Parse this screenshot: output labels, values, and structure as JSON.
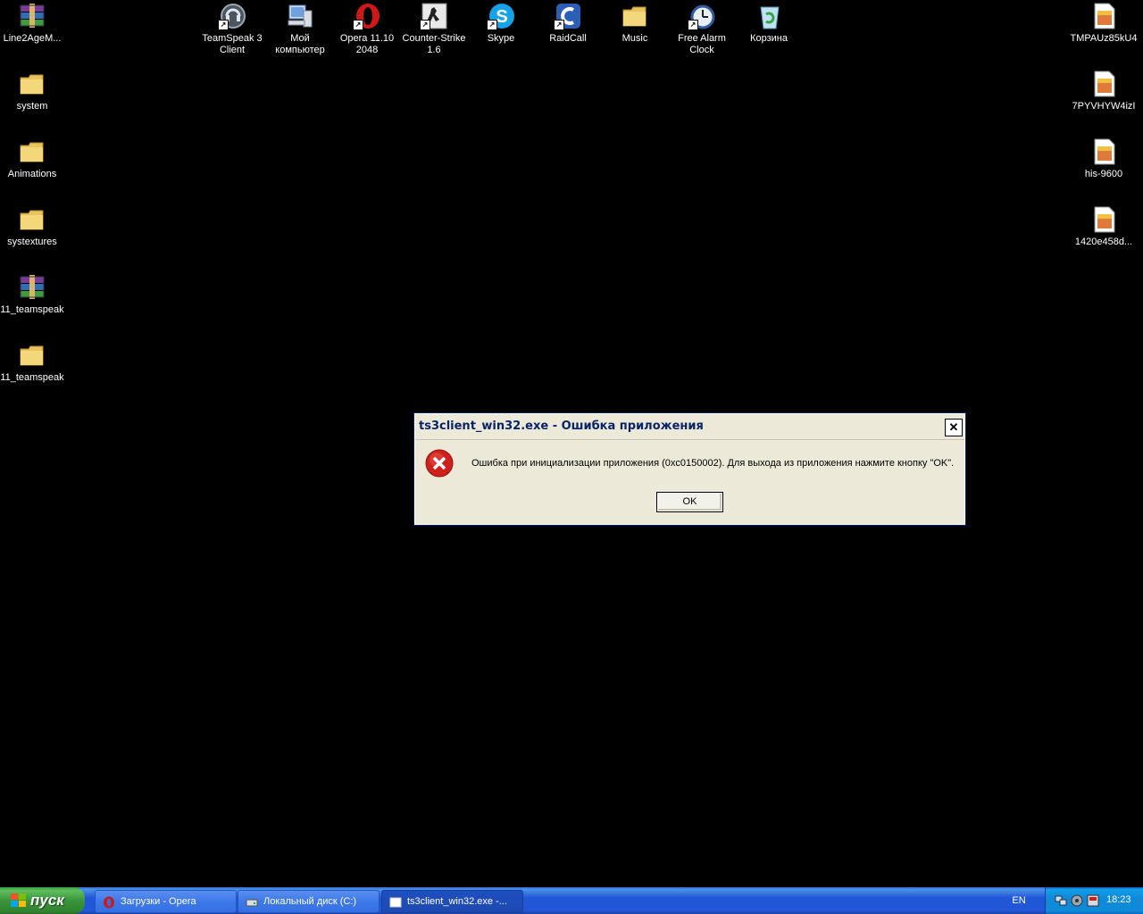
{
  "desktop": {
    "left_icons": [
      {
        "label": "Line2AgeM...",
        "icon": "winrar-archive-icon"
      },
      {
        "label": "system",
        "icon": "folder-icon"
      },
      {
        "label": "Animations",
        "icon": "folder-icon"
      },
      {
        "label": "systextures",
        "icon": "folder-icon"
      },
      {
        "label": "11_teamspeak",
        "icon": "winrar-archive-icon"
      },
      {
        "label": "11_teamspeak",
        "icon": "folder-icon"
      }
    ],
    "top_icons": [
      {
        "label": "TeamSpeak 3 Client",
        "icon": "teamspeak-icon"
      },
      {
        "label": "Мой компьютер",
        "icon": "my-computer-icon"
      },
      {
        "label": "Opera 11.10 2048",
        "icon": "opera-icon"
      },
      {
        "label": "Counter-Strike 1.6",
        "icon": "counter-strike-icon"
      },
      {
        "label": "Skype",
        "icon": "skype-icon"
      },
      {
        "label": "RaidCall",
        "icon": "raidcall-icon"
      },
      {
        "label": "Music",
        "icon": "folder-icon"
      },
      {
        "label": "Free Alarm Clock",
        "icon": "alarm-clock-icon"
      },
      {
        "label": "Корзина",
        "icon": "recycle-bin-icon"
      }
    ],
    "right_icons": [
      {
        "label": "TMPAUz85kU4",
        "icon": "image-file-icon"
      },
      {
        "label": "7PYVHYW4izI",
        "icon": "image-file-icon"
      },
      {
        "label": "his-9600",
        "icon": "image-file-icon"
      },
      {
        "label": "1420e458d...",
        "icon": "image-file-icon"
      }
    ]
  },
  "dialog": {
    "title": "ts3client_win32.exe - Ошибка приложения",
    "message": "Ошибка при инициализации приложения (0xc0150002). Для выхода из приложения нажмите кнопку \"OK\".",
    "ok_label": "OK",
    "close_symbol": "✕"
  },
  "taskbar": {
    "start_label": "пуск",
    "tasks": [
      {
        "label": "Загрузки - Opera",
        "icon": "opera-icon"
      },
      {
        "label": "Локальный диск (C:)",
        "icon": "drive-icon"
      },
      {
        "label": "ts3client_win32.exe -...",
        "icon": "window-icon"
      }
    ],
    "language": "EN",
    "clock": "18:23"
  },
  "colors": {
    "desktop_background": "#000000",
    "taskbar_blue": "#2157d7",
    "start_green": "#3a943a",
    "dialog_face": "#ece9d8",
    "error_red": "#d0201a"
  }
}
